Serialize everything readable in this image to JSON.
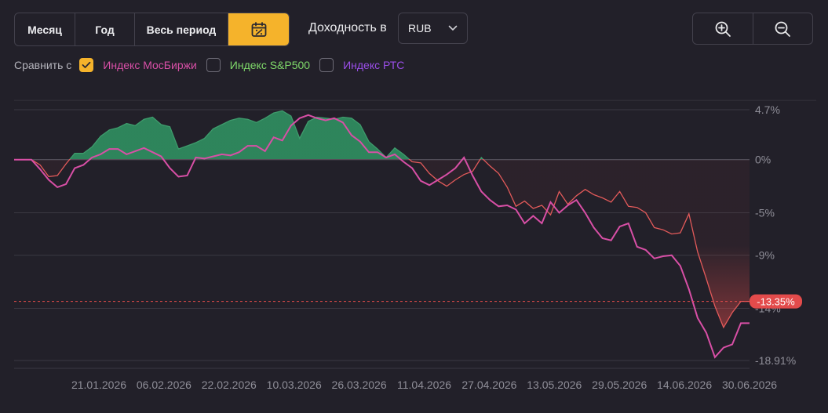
{
  "periods": [
    {
      "label": "Месяц",
      "active": false
    },
    {
      "label": "Год",
      "active": false
    },
    {
      "label": "Весь период",
      "active": false
    }
  ],
  "calendar_button": {
    "icon": "calendar-percent-icon",
    "active": true
  },
  "yield": {
    "label": "Доходность в",
    "currency": "RUB"
  },
  "zoom": {
    "in_icon": "zoom-in-icon",
    "out_icon": "zoom-out-icon"
  },
  "compare": {
    "label": "Сравнить с",
    "items": [
      {
        "label": "Индекс МосБиржи",
        "checked": true,
        "color": "#d84fa6"
      },
      {
        "label": "Индекс S&P500",
        "checked": false,
        "color": "#7fd96a"
      },
      {
        "label": "Индекс РТС",
        "checked": false,
        "color": "#9a4ee8"
      }
    ]
  },
  "colors": {
    "accent": "#f5b32b",
    "positive": "#2f8a5e",
    "negative": "#e34b4b",
    "background": "#222029"
  },
  "chart_data": {
    "type": "area",
    "y_ticks": [
      "4.7%",
      "0%",
      "-5%",
      "-9%",
      "-14%",
      "-18.91%"
    ],
    "y_tick_values": [
      4.7,
      0,
      -5,
      -9,
      -14,
      -18.91
    ],
    "ylim": [
      -19.4,
      5.5
    ],
    "x_ticks": [
      "21.01.2026",
      "06.02.2026",
      "22.02.2026",
      "10.03.2026",
      "26.03.2026",
      "11.04.2026",
      "27.04.2026",
      "13.05.2026",
      "29.05.2026",
      "14.06.2026",
      "30.06.2026"
    ],
    "current_value_label": "-13.35%",
    "current_value": -13.35,
    "grid": true,
    "series": [
      {
        "name": "",
        "color": "#e35a5a",
        "values": [
          0,
          0,
          0,
          -0.5,
          -1.6,
          -1.5,
          -0.4,
          0.6,
          0.6,
          1.2,
          2.2,
          2.8,
          3.0,
          3.4,
          3.2,
          3.8,
          4.0,
          3.3,
          3.1,
          1.0,
          1.3,
          1.6,
          2.0,
          2.9,
          3.3,
          3.7,
          3.9,
          3.8,
          3.5,
          3.9,
          4.4,
          4.6,
          4.1,
          2.0,
          3.6,
          4.0,
          3.9,
          3.8,
          4.0,
          3.9,
          3.3,
          1.7,
          1.0,
          0.2,
          1.1,
          0.5,
          -0.2,
          -0.3,
          -1.3,
          -2.0,
          -2.5,
          -1.9,
          -1.4,
          -1.1,
          0.2,
          -0.6,
          -1.3,
          -2.6,
          -4.4,
          -3.9,
          -4.6,
          -4.3,
          -5.2,
          -3.0,
          -4.2,
          -3.4,
          -2.8,
          -3.3,
          -3.6,
          -4.0,
          -3.0,
          -4.4,
          -4.5,
          -5.0,
          -6.4,
          -6.6,
          -7.0,
          -6.9,
          -5.1,
          -8.7,
          -11.2,
          -13.8,
          -15.8,
          -14.4,
          -13.35,
          -13.35
        ]
      },
      {
        "name": "Индекс МосБиржи",
        "color": "#d84fa6",
        "values": [
          0,
          0,
          0,
          -0.9,
          -1.9,
          -2.6,
          -2.3,
          -0.8,
          -0.5,
          0.2,
          0.5,
          1.0,
          1.0,
          0.5,
          0.8,
          1.1,
          0.7,
          0.3,
          -0.8,
          -1.6,
          -1.5,
          0.2,
          0.1,
          0.3,
          0.5,
          0.4,
          0.7,
          1.3,
          1.3,
          0.8,
          2.1,
          1.8,
          3.2,
          3.9,
          4.2,
          3.9,
          3.7,
          3.9,
          3.5,
          2.3,
          1.7,
          0.7,
          0.7,
          0.2,
          0.5,
          -0.2,
          -0.8,
          -2.0,
          -2.4,
          -1.9,
          -1.4,
          -0.8,
          0.2,
          -1.5,
          -3.0,
          -3.8,
          -4.4,
          -4.3,
          -4.7,
          -6.0,
          -5.3,
          -6.0,
          -4.0,
          -5.0,
          -4.3,
          -3.8,
          -5.0,
          -6.4,
          -7.4,
          -7.6,
          -6.3,
          -6.0,
          -8.2,
          -8.5,
          -9.3,
          -9.1,
          -9.0,
          -10.0,
          -12.2,
          -14.9,
          -16.3,
          -18.6,
          -17.7,
          -17.4,
          -15.4,
          -15.4
        ]
      }
    ]
  }
}
